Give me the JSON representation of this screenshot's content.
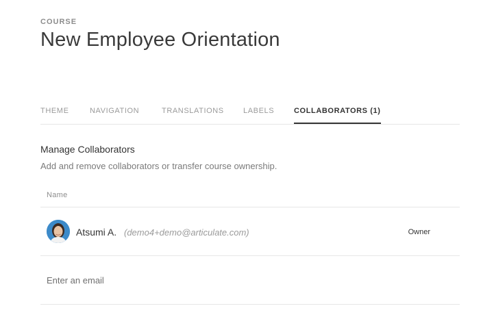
{
  "header": {
    "eyebrow": "COURSE",
    "title": "New Employee Orientation"
  },
  "tabs": [
    {
      "label": "THEME",
      "active": false
    },
    {
      "label": "NAVIGATION",
      "active": false
    },
    {
      "label": "TRANSLATIONS",
      "active": false
    },
    {
      "label": "LABELS",
      "active": false
    },
    {
      "label": "COLLABORATORS (1)",
      "active": true
    }
  ],
  "collaborators": {
    "title": "Manage Collaborators",
    "description": "Add and remove collaborators or transfer course ownership.",
    "column_name": "Name",
    "rows": [
      {
        "name": "Atsumi A.",
        "email": "(demo4+demo@articulate.com)",
        "role": "Owner"
      }
    ],
    "email_placeholder": "Enter an email"
  },
  "colors": {
    "accent_text": "#333333",
    "muted_text": "#8c8c8c",
    "divider": "#e6e6e6",
    "avatar_bg": "#3c8ac9"
  }
}
